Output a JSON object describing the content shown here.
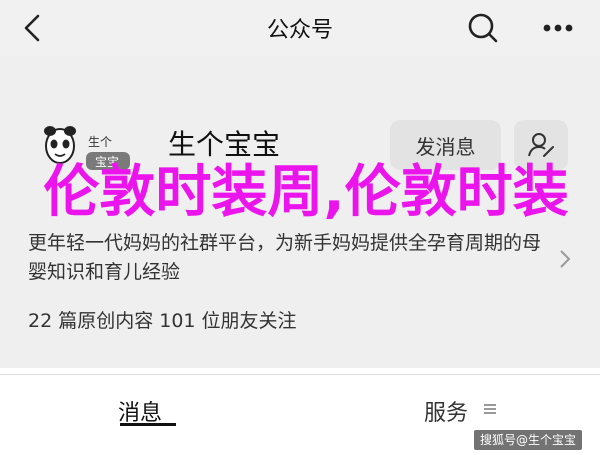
{
  "header": {
    "title": "公众号",
    "back_icon": "back-arrow-icon",
    "search_icon": "search-icon",
    "more_icon": "more-icon"
  },
  "account": {
    "name": "生个宝宝",
    "logo_text": "生个宝宝",
    "message_button_label": "发消息",
    "description": "更年轻一代妈妈的社群平台，为新手妈妈提供全孕育周期的母婴知识和育儿经验",
    "stats": "22 篇原创内容  101 位朋友关注"
  },
  "overlay": {
    "text": "伦敦时装周,伦敦时装",
    "color": "#ec14ec"
  },
  "bottom_tabs": [
    {
      "label": "消息",
      "active": true
    },
    {
      "label": "服务",
      "active": false
    }
  ],
  "watermark": "搜狐号@生个宝宝"
}
